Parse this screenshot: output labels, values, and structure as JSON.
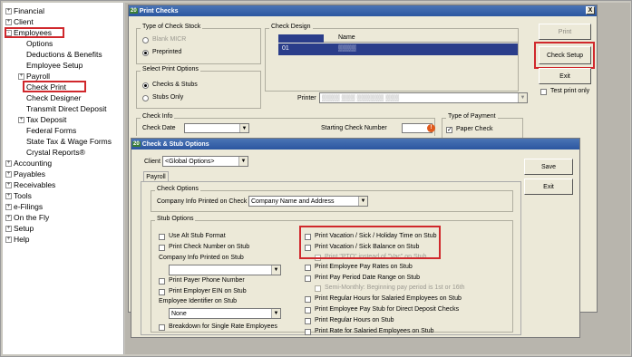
{
  "tree": {
    "items": [
      {
        "label": "Financial",
        "expander": "+"
      },
      {
        "label": "Client",
        "expander": "+"
      },
      {
        "label": "Employees",
        "expander": "-"
      },
      {
        "label": "Options",
        "expander": ""
      },
      {
        "label": "Deductions & Benefits",
        "expander": ""
      },
      {
        "label": "Employee Setup",
        "expander": ""
      },
      {
        "label": "Payroll",
        "expander": "+"
      },
      {
        "label": "Check Print",
        "expander": ""
      },
      {
        "label": "Check Designer",
        "expander": ""
      },
      {
        "label": "Transmit Direct Deposit",
        "expander": ""
      },
      {
        "label": "Tax Deposit",
        "expander": "+"
      },
      {
        "label": "Federal Forms",
        "expander": ""
      },
      {
        "label": "State Tax & Wage Forms",
        "expander": ""
      },
      {
        "label": "Crystal Reports®",
        "expander": ""
      },
      {
        "label": "Accounting",
        "expander": "+"
      },
      {
        "label": "Payables",
        "expander": "+"
      },
      {
        "label": "Receivables",
        "expander": "+"
      },
      {
        "label": "Tools",
        "expander": "+"
      },
      {
        "label": "e-Filings",
        "expander": "+"
      },
      {
        "label": "On the Fly",
        "expander": "+"
      },
      {
        "label": "Setup",
        "expander": "+"
      },
      {
        "label": "Help",
        "expander": "+"
      }
    ]
  },
  "print_checks": {
    "title_icon": "20",
    "title": "Print Checks",
    "close": "X",
    "check_stock": {
      "label": "Type of Check Stock",
      "options": [
        "Blank MICR",
        "Preprinted"
      ]
    },
    "check_design": {
      "label": "Check Design",
      "col_name": "Name",
      "row_id": "01",
      "row_name": "▒▒▒▒"
    },
    "print_options": {
      "label": "Select Print Options",
      "options": [
        "Checks & Stubs",
        "Stubs Only"
      ]
    },
    "printer_label": "Printer",
    "printer_value": "▒▒▒▒ ▒▒▒ ▒▒▒▒▒▒ ▒▒▒",
    "check_info": {
      "label": "Check Info",
      "date_label": "Check Date",
      "starting_label": "Starting Check Number"
    },
    "payment": {
      "label": "Type of Payment",
      "paper_check": "Paper Check"
    },
    "buttons": {
      "print": "Print",
      "check_setup": "Check Setup",
      "exit": "Exit"
    },
    "test_print": "Test print only"
  },
  "stub_options": {
    "title_icon": "20",
    "title": "Check & Stub Options",
    "client_label": "Client",
    "client_value": "<Global Options>",
    "tab": "Payroll",
    "buttons": {
      "save": "Save",
      "exit": "Exit"
    },
    "check_options": {
      "label": "Check Options",
      "company_label": "Company Info Printed on Check",
      "company_value": "Company Name and Address"
    },
    "stub_group_label": "Stub Options",
    "left": {
      "alt_stub": "Use Alt Stub Format",
      "print_check_number": "Print Check Number on Stub",
      "company_info_label": "Company Info Printed on Stub",
      "company_info_value": "",
      "payer_phone": "Print Payer Phone Number",
      "employer_ein": "Print Employer EIN on Stub",
      "employee_id_label": "Employee Identifier on Stub",
      "employee_id_value": "None",
      "breakdown": "Breakdown for Single Rate Employees"
    },
    "right": [
      {
        "label": "Print Vacation / Sick / Holiday Time on Stub",
        "disabled": false
      },
      {
        "label": "Print Vacation / Sick Balance on Stub",
        "disabled": false
      },
      {
        "label": "Print \"PTO\" instead of \"Vac\" on Stub",
        "disabled": true
      },
      {
        "label": "Print Employee Pay Rates on Stub",
        "disabled": false
      },
      {
        "label": "Print Pay Period Date Range on Stub",
        "disabled": false
      },
      {
        "label": "Semi-Monthly: Beginning pay period is 1st or 16th",
        "disabled": true
      },
      {
        "label": "Print Regular Hours for Salaried Employees on Stub",
        "disabled": false
      },
      {
        "label": "Print Employee Pay Stub for Direct Deposit Checks",
        "disabled": false
      },
      {
        "label": "Print Regular Hours on Stub",
        "disabled": false
      },
      {
        "label": "Print Rate for Salaried Employees on Stub",
        "disabled": false
      }
    ]
  }
}
